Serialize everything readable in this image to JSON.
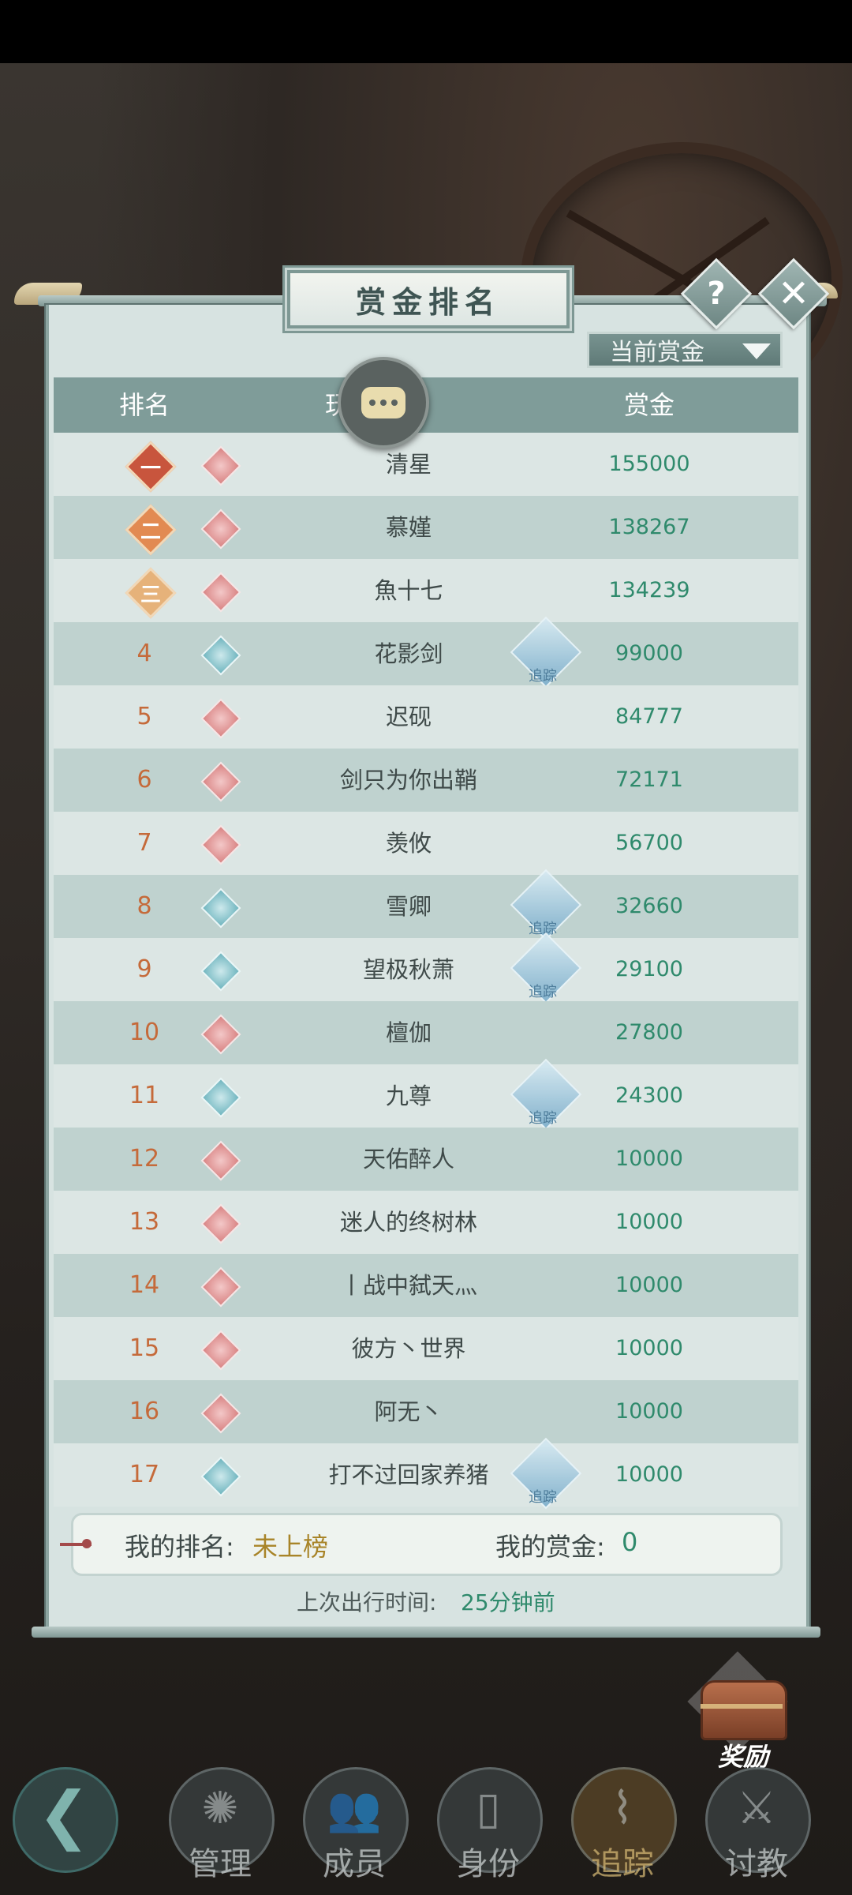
{
  "title": "赏金排名",
  "header_buttons": {
    "help": "?",
    "close": "✕"
  },
  "sort": {
    "selected": "当前赏金"
  },
  "columns": {
    "rank": "排名",
    "player": "玩",
    "bounty": "赏金"
  },
  "medals": [
    "一",
    "二",
    "三"
  ],
  "track_label": "追踪",
  "rows": [
    {
      "rank": "1",
      "name": "清星",
      "bounty": "155000"
    },
    {
      "rank": "2",
      "name": "慕嫤",
      "bounty": "138267"
    },
    {
      "rank": "3",
      "name": "魚十七",
      "bounty": "134239"
    },
    {
      "rank": "4",
      "name": "花影剑",
      "bounty": "99000"
    },
    {
      "rank": "5",
      "name": "迟砚",
      "bounty": "84777"
    },
    {
      "rank": "6",
      "name": "剑只为你出鞘",
      "bounty": "72171"
    },
    {
      "rank": "7",
      "name": "羡攸",
      "bounty": "56700"
    },
    {
      "rank": "8",
      "name": "雪卿",
      "bounty": "32660"
    },
    {
      "rank": "9",
      "name": "望极秋萧",
      "bounty": "29100"
    },
    {
      "rank": "10",
      "name": "檀伽",
      "bounty": "27800"
    },
    {
      "rank": "11",
      "name": "九尊",
      "bounty": "24300"
    },
    {
      "rank": "12",
      "name": "天佑醉人",
      "bounty": "10000"
    },
    {
      "rank": "13",
      "name": "迷人的终树林",
      "bounty": "10000"
    },
    {
      "rank": "14",
      "name": "丨战中弑天灬",
      "bounty": "10000"
    },
    {
      "rank": "15",
      "name": "彼方丶世界",
      "bounty": "10000"
    },
    {
      "rank": "16",
      "name": "阿无丶",
      "bounty": "10000"
    },
    {
      "rank": "17",
      "name": "打不过回家养猪",
      "bounty": "10000"
    }
  ],
  "my_status": {
    "rank_label": "我的排名:",
    "rank_value": "未上榜",
    "bounty_label": "我的赏金:",
    "bounty_value": "0"
  },
  "last_outing": {
    "label": "上次出行时间:",
    "value": "25分钟前"
  },
  "reward": {
    "label": "奖励"
  },
  "nav": {
    "back_glyph": "❮",
    "manage": "管理",
    "members": "成员",
    "identity": "身份",
    "track": "追踪",
    "teach": "讨教"
  },
  "colors": {
    "accent_green": "#2f8a6c",
    "rank_orange": "#c56a3a",
    "panel_teal": "#7f9c99"
  }
}
